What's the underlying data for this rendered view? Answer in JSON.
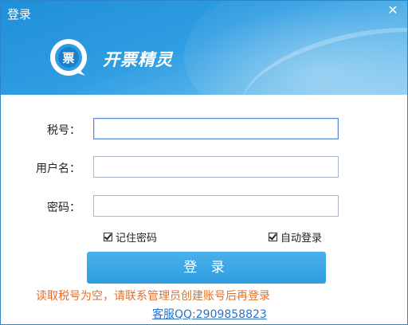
{
  "window": {
    "title": "登录",
    "close_glyph": "✕"
  },
  "brand": {
    "logo_glyph": "票",
    "name": "开票精灵"
  },
  "form": {
    "tax_id_label": "税号：",
    "tax_id_value": "",
    "username_label": "用户名：",
    "username_value": "",
    "password_label": "密码：",
    "password_value": ""
  },
  "options": {
    "remember_password_label": "记住密码",
    "remember_password_checked": true,
    "auto_login_label": "自动登录",
    "auto_login_checked": true
  },
  "actions": {
    "login_label": "登 录"
  },
  "messages": {
    "error": "读取税号为空，请联系管理员创建账号后再登录"
  },
  "support": {
    "link_text": "客服QQ:2909858823"
  },
  "colors": {
    "header_blue": "#1f8fd8",
    "button_blue": "#2f9de2",
    "error_orange": "#e0702c",
    "link_blue": "#2a72c8"
  }
}
